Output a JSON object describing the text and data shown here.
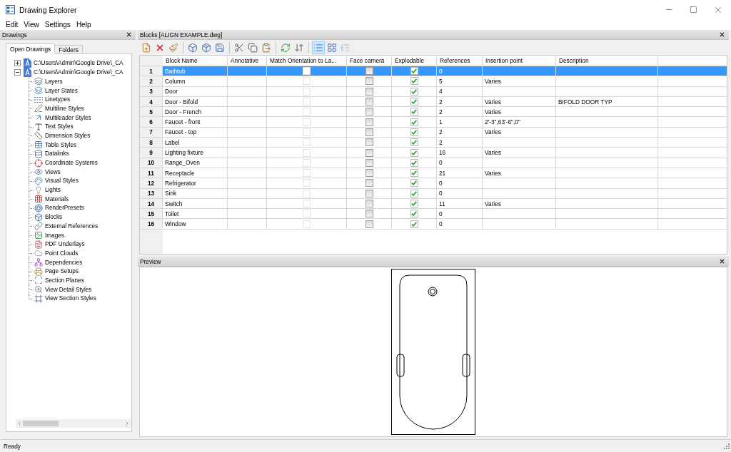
{
  "window": {
    "title": "Drawing Explorer"
  },
  "menu": [
    "Edit",
    "View",
    "Settings",
    "Help"
  ],
  "drawings_panel": {
    "title": "Drawings",
    "tabs": [
      {
        "label": "Open Drawings",
        "selected": true
      },
      {
        "label": "Folders",
        "selected": false
      }
    ],
    "tree": [
      {
        "label": "C:\\Users\\Admin\\Google Drive\\_CA",
        "expanded": false
      },
      {
        "label": "C:\\Users\\Admin\\Google Drive\\_CA",
        "expanded": true,
        "children": [
          {
            "label": "Layers",
            "kind": "layers"
          },
          {
            "label": "Layer States",
            "kind": "layer-states"
          },
          {
            "label": "Linetypes",
            "kind": "linetypes"
          },
          {
            "label": "Multiline Styles",
            "kind": "multiline"
          },
          {
            "label": "Multileader Styles",
            "kind": "multileader"
          },
          {
            "label": "Text Styles",
            "kind": "text"
          },
          {
            "label": "Dimension Styles",
            "kind": "dimension"
          },
          {
            "label": "Table Styles",
            "kind": "table"
          },
          {
            "label": "Datalinks",
            "kind": "datalinks"
          },
          {
            "label": "Coordinate Systems",
            "kind": "coordinates"
          },
          {
            "label": "Views",
            "kind": "views"
          },
          {
            "label": "Visual Styles",
            "kind": "visual-styles"
          },
          {
            "label": "Lights",
            "kind": "lights"
          },
          {
            "label": "Materials",
            "kind": "materials"
          },
          {
            "label": "RenderPresets",
            "kind": "render-presets"
          },
          {
            "label": "Blocks",
            "kind": "blocks"
          },
          {
            "label": "External References",
            "kind": "xrefs"
          },
          {
            "label": "Images",
            "kind": "images"
          },
          {
            "label": "PDF Underlays",
            "kind": "pdf"
          },
          {
            "label": "Point Clouds",
            "kind": "point-clouds"
          },
          {
            "label": "Dependencies",
            "kind": "dependencies"
          },
          {
            "label": "Page Setups",
            "kind": "page-setups"
          },
          {
            "label": "Section Planes",
            "kind": "section-planes"
          },
          {
            "label": "View Detail Styles",
            "kind": "detail-styles"
          },
          {
            "label": "View Section Styles",
            "kind": "section-styles"
          }
        ]
      }
    ]
  },
  "blocks_panel": {
    "title": "Blocks [ALIGN EXAMPLE.dwg]",
    "toolbar": [
      [
        {
          "kind": "new-block"
        },
        {
          "kind": "delete"
        },
        {
          "kind": "purge"
        }
      ],
      [
        {
          "kind": "insert"
        },
        {
          "kind": "insert-new"
        },
        {
          "kind": "insert-file"
        }
      ],
      [
        {
          "kind": "cut"
        },
        {
          "kind": "copy"
        },
        {
          "kind": "paste"
        }
      ],
      [
        {
          "kind": "refresh"
        },
        {
          "kind": "swap"
        }
      ],
      [
        {
          "kind": "details-view",
          "selected": true,
          "disabled": false
        },
        {
          "kind": "icons-view",
          "selected": false,
          "disabled": false
        },
        {
          "kind": "tree-view",
          "selected": false,
          "disabled": true
        }
      ]
    ],
    "table": {
      "columns": [
        "Block Name",
        "Annotative",
        "Match Orientation to La...",
        "Face camera",
        "Explodable",
        "References",
        "Insertion point",
        "Description"
      ],
      "rows": [
        {
          "number": "1",
          "selected": true,
          "name": "Bathtub",
          "match_orientation": {
            "checked": false,
            "disabled": true
          },
          "face_camera": {
            "checked": false,
            "disabled": false
          },
          "explodable": {
            "checked": true,
            "disabled": false
          },
          "references": "0"
        },
        {
          "number": "2",
          "selected": false,
          "name": "Column",
          "match_orientation": {
            "checked": false,
            "disabled": true
          },
          "face_camera": {
            "checked": false,
            "disabled": false
          },
          "explodable": {
            "checked": true,
            "disabled": false
          },
          "references": "5",
          "insertion_point": "Varies"
        },
        {
          "number": "3",
          "selected": false,
          "name": "Door",
          "match_orientation": {
            "checked": false,
            "disabled": true
          },
          "face_camera": {
            "checked": false,
            "disabled": false
          },
          "explodable": {
            "checked": true,
            "disabled": false
          },
          "references": "4"
        },
        {
          "number": "4",
          "selected": false,
          "name": "Door - Bifold",
          "match_orientation": {
            "checked": false,
            "disabled": true
          },
          "face_camera": {
            "checked": false,
            "disabled": false
          },
          "explodable": {
            "checked": true,
            "disabled": false
          },
          "references": "2",
          "insertion_point": "Varies",
          "description": "BIFOLD DOOR TYP"
        },
        {
          "number": "5",
          "selected": false,
          "name": "Door - French",
          "match_orientation": {
            "checked": false,
            "disabled": true
          },
          "face_camera": {
            "checked": false,
            "disabled": false
          },
          "explodable": {
            "checked": true,
            "disabled": false
          },
          "references": "2",
          "insertion_point": "Varies"
        },
        {
          "number": "6",
          "selected": false,
          "name": "Faucet - front",
          "match_orientation": {
            "checked": false,
            "disabled": true
          },
          "face_camera": {
            "checked": false,
            "disabled": false
          },
          "explodable": {
            "checked": true,
            "disabled": false
          },
          "references": "1",
          "insertion_point": "2'-3\",63'-6\",0\""
        },
        {
          "number": "7",
          "selected": false,
          "name": "Faucet - top",
          "match_orientation": {
            "checked": false,
            "disabled": true
          },
          "face_camera": {
            "checked": false,
            "disabled": false
          },
          "explodable": {
            "checked": true,
            "disabled": false
          },
          "references": "2",
          "insertion_point": "Varies"
        },
        {
          "number": "8",
          "selected": false,
          "name": "Label",
          "match_orientation": {
            "checked": false,
            "disabled": true
          },
          "face_camera": {
            "checked": false,
            "disabled": false
          },
          "explodable": {
            "checked": true,
            "disabled": false
          },
          "references": "2"
        },
        {
          "number": "9",
          "selected": false,
          "name": "Lighting fixture",
          "match_orientation": {
            "checked": false,
            "disabled": true
          },
          "face_camera": {
            "checked": false,
            "disabled": false
          },
          "explodable": {
            "checked": true,
            "disabled": false
          },
          "references": "16",
          "insertion_point": "Varies"
        },
        {
          "number": "10",
          "selected": false,
          "name": "Range_Oven",
          "match_orientation": {
            "checked": false,
            "disabled": true
          },
          "face_camera": {
            "checked": false,
            "disabled": false
          },
          "explodable": {
            "checked": true,
            "disabled": false
          },
          "references": "0"
        },
        {
          "number": "11",
          "selected": false,
          "name": "Receptacle",
          "match_orientation": {
            "checked": false,
            "disabled": true
          },
          "face_camera": {
            "checked": false,
            "disabled": false
          },
          "explodable": {
            "checked": true,
            "disabled": false
          },
          "references": "21",
          "insertion_point": "Varies"
        },
        {
          "number": "12",
          "selected": false,
          "name": "Refrigerator",
          "match_orientation": {
            "checked": false,
            "disabled": true
          },
          "face_camera": {
            "checked": false,
            "disabled": false
          },
          "explodable": {
            "checked": true,
            "disabled": false
          },
          "references": "0"
        },
        {
          "number": "13",
          "selected": false,
          "name": "Sink",
          "match_orientation": {
            "checked": false,
            "disabled": true
          },
          "face_camera": {
            "checked": false,
            "disabled": false
          },
          "explodable": {
            "checked": true,
            "disabled": false
          },
          "references": "0"
        },
        {
          "number": "14",
          "selected": false,
          "name": "Switch",
          "match_orientation": {
            "checked": false,
            "disabled": true
          },
          "face_camera": {
            "checked": false,
            "disabled": false
          },
          "explodable": {
            "checked": true,
            "disabled": false
          },
          "references": "11",
          "insertion_point": "Varies"
        },
        {
          "number": "15",
          "selected": false,
          "name": "Toilet",
          "match_orientation": {
            "checked": false,
            "disabled": true
          },
          "face_camera": {
            "checked": false,
            "disabled": false
          },
          "explodable": {
            "checked": true,
            "disabled": false
          },
          "references": "0"
        },
        {
          "number": "16",
          "selected": false,
          "name": "Window",
          "match_orientation": {
            "checked": false,
            "disabled": true
          },
          "face_camera": {
            "checked": false,
            "disabled": false
          },
          "explodable": {
            "checked": true,
            "disabled": false
          },
          "references": "0"
        }
      ]
    }
  },
  "preview_panel": {
    "title": "Preview"
  },
  "status_bar": {
    "text": "Ready"
  }
}
